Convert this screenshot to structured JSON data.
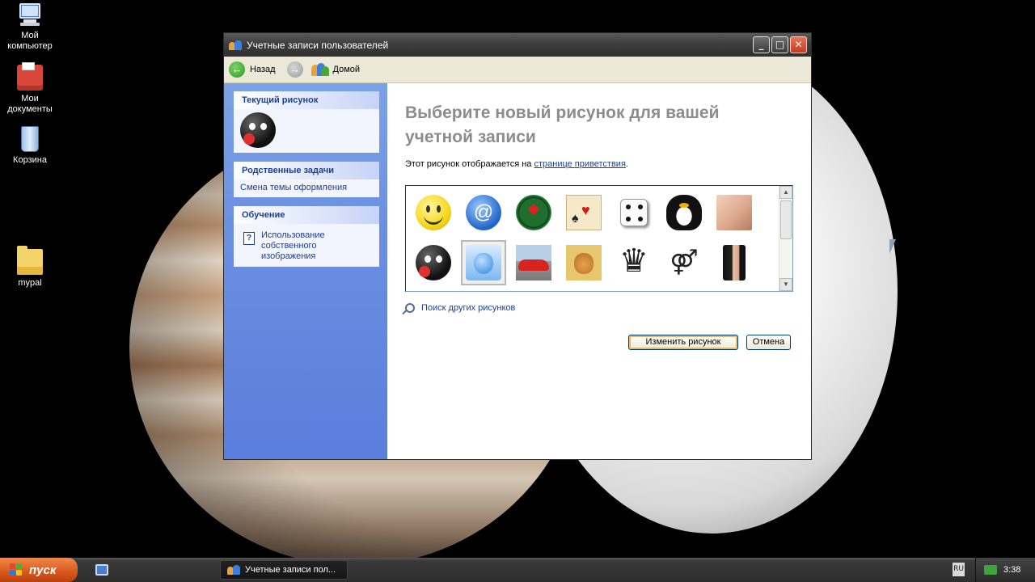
{
  "desktop": {
    "icons": [
      {
        "label": "Мой компьютер",
        "icon": "my-computer-icon"
      },
      {
        "label": "Мои документы",
        "icon": "my-documents-icon"
      },
      {
        "label": "Корзина",
        "icon": "recycle-bin-icon"
      },
      {
        "label": "mypal",
        "icon": "folder-icon"
      }
    ]
  },
  "window": {
    "title": "Учетные записи пользователей",
    "controls": {
      "minimize": "_",
      "maximize": "□",
      "close": "✕"
    },
    "toolbar": {
      "back_label": "Назад",
      "home_label": "Домой"
    },
    "taskpane": {
      "current_picture": {
        "header": "Текущий рисунок",
        "picture": "bomb"
      },
      "related_tasks": {
        "header": "Родственные задачи",
        "items": [
          "Смена темы оформления"
        ]
      },
      "learn": {
        "header": "Обучение",
        "items": [
          "Использование собственного изображения"
        ]
      }
    },
    "main": {
      "heading": "Выберите новый рисунок для вашей учетной записи",
      "subtext_prefix": "Этот рисунок отображается на ",
      "subtext_link": "странице приветствия",
      "subtext_suffix": ".",
      "pictures": [
        {
          "name": "smiley"
        },
        {
          "name": "email-at"
        },
        {
          "name": "beer-cap"
        },
        {
          "name": "playing-cards"
        },
        {
          "name": "dice"
        },
        {
          "name": "penguin"
        },
        {
          "name": "skin"
        },
        {
          "name": "bomb"
        },
        {
          "name": "apple",
          "selected": true
        },
        {
          "name": "red-car"
        },
        {
          "name": "kitten"
        },
        {
          "name": "chess-queen"
        },
        {
          "name": "gender-symbol",
          "glyph": "⚤"
        },
        {
          "name": "woman"
        }
      ],
      "search_link": "Поиск других рисунков",
      "change_button": "Изменить рисунок",
      "cancel_button": "Отмена"
    }
  },
  "taskbar": {
    "start_label": "пуск",
    "task_label": "Учетные записи пол...",
    "language": "RU",
    "clock": "3:38"
  },
  "colors": {
    "taskpane_blue": "#6b8fe0",
    "link_blue": "#1c3f94",
    "heading_gray": "#8c8c8c",
    "start_orange": "#d9561b"
  }
}
